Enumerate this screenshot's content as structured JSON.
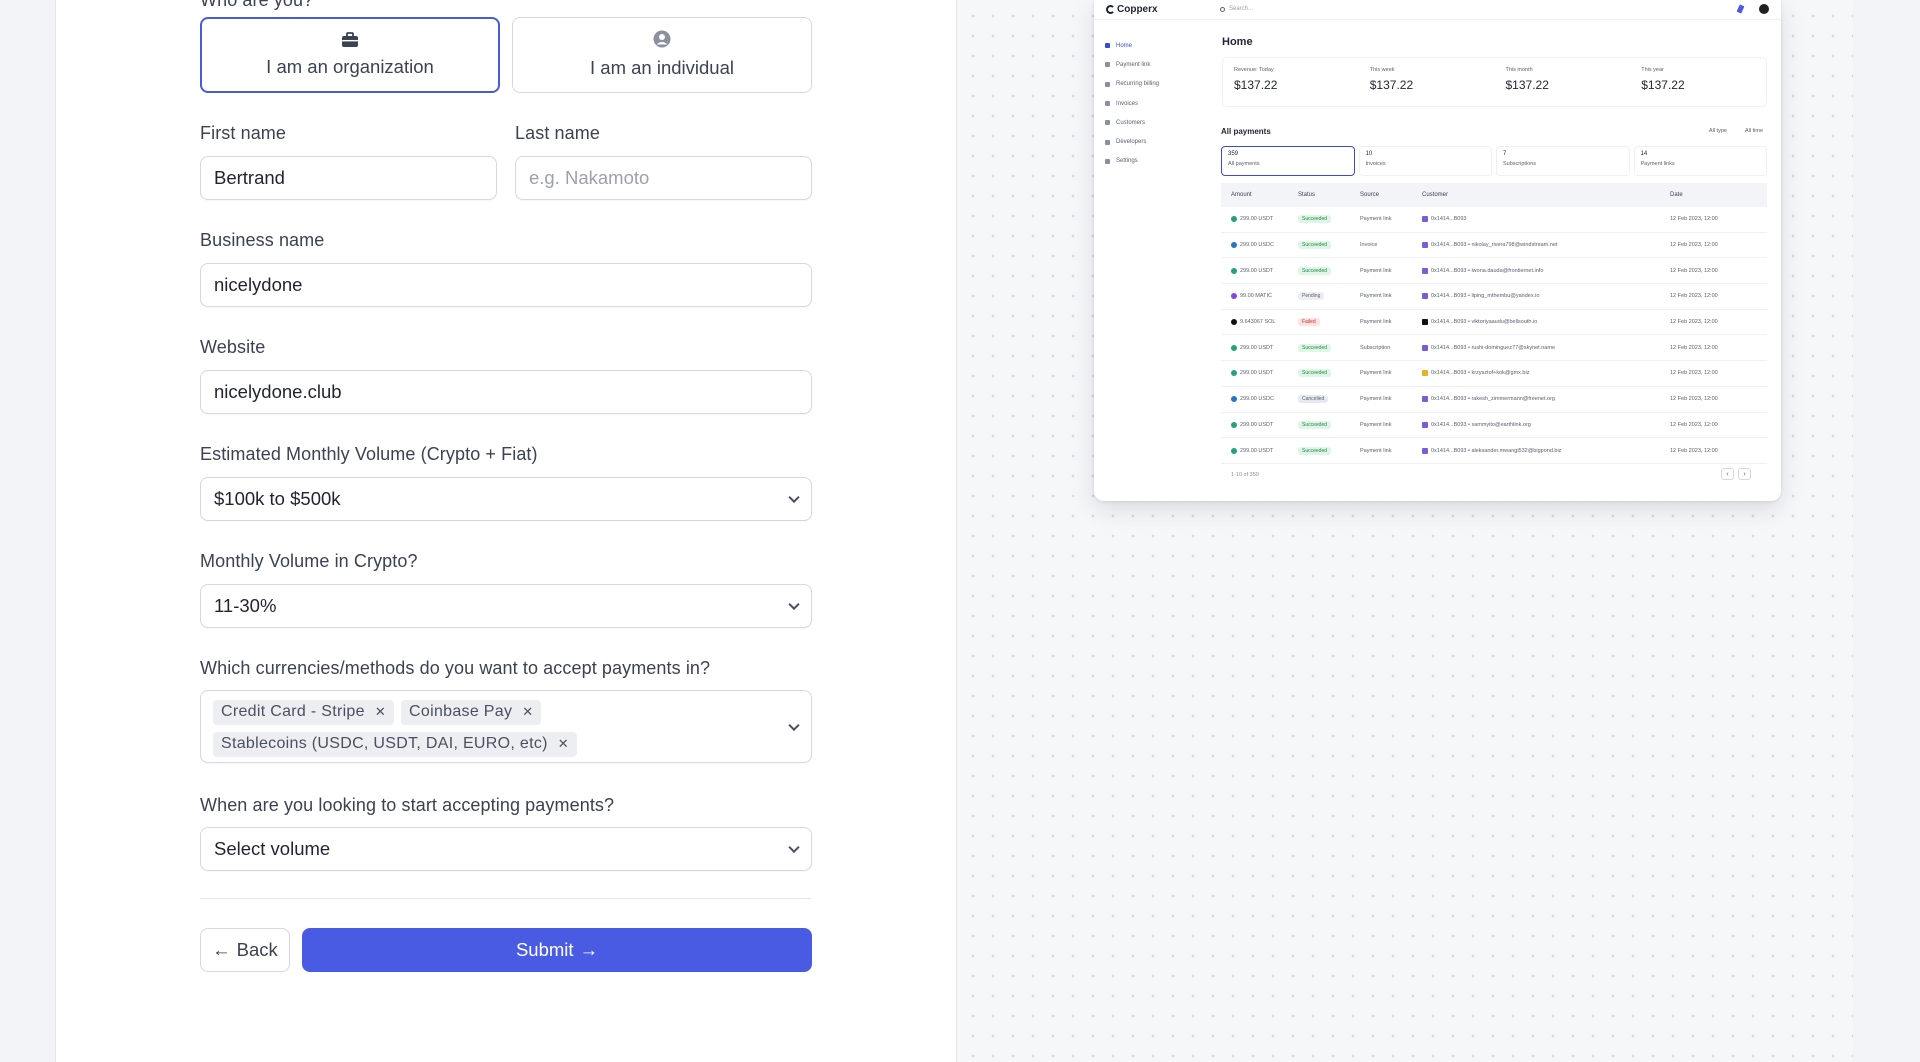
{
  "form": {
    "who_label": "Who are you?",
    "org_card": "I am an organization",
    "ind_card": "I am an individual",
    "first_name": {
      "label": "First name",
      "value": "Bertrand"
    },
    "last_name": {
      "label": "Last name",
      "placeholder": "e.g. Nakamoto"
    },
    "business_name": {
      "label": "Business name",
      "value": "nicelydone"
    },
    "website": {
      "label": "Website",
      "value": "nicelydone.club"
    },
    "monthly_volume": {
      "label": "Estimated Monthly Volume (Crypto + Fiat)",
      "value": "$100k to $500k"
    },
    "crypto_volume": {
      "label": "Monthly Volume in Crypto?",
      "value": "11-30%"
    },
    "currencies": {
      "label": "Which currencies/methods do you want to accept payments in?",
      "chips": [
        "Credit Card - Stripe",
        "Coinbase Pay",
        "Stablecoins (USDC, USDT, DAI, EURO, etc)"
      ]
    },
    "start_time": {
      "label": "When are you looking to start accepting payments?",
      "value": "Select volume"
    },
    "back_label": "Back",
    "submit_label": "Submit"
  },
  "preview": {
    "brand": "Copperx",
    "search_placeholder": "Search...",
    "sidebar": [
      "Home",
      "Payment link",
      "Recurring billing",
      "Invoices",
      "Customers",
      "Developers",
      "Settings"
    ],
    "page_title": "Home",
    "stats": [
      {
        "label": "Revenue: Today",
        "value": "$137.22"
      },
      {
        "label": "This week",
        "value": "$137.22"
      },
      {
        "label": "This month",
        "value": "$137.22"
      },
      {
        "label": "This year",
        "value": "$137.22"
      }
    ],
    "all_payments": "All payments",
    "filters": [
      "All type",
      "All time"
    ],
    "tabs": [
      {
        "count": "359",
        "label": "All payments"
      },
      {
        "count": "10",
        "label": "Invoices"
      },
      {
        "count": "7",
        "label": "Subscriptions"
      },
      {
        "count": "14",
        "label": "Payment links"
      }
    ],
    "columns": [
      "Amount",
      "Status",
      "Source",
      "Customer",
      "Date"
    ],
    "rows": [
      {
        "amount": "299.00 USDT",
        "coin": "#26a17b",
        "status": "Succeeded",
        "kind": "succ",
        "source": "Payment link",
        "sq": "#7c5cd6",
        "customer": "0x1414...B093",
        "date": "12 Feb 2023, 12:00"
      },
      {
        "amount": "299.00 USDC",
        "coin": "#2775ca",
        "status": "Succeeded",
        "kind": "succ",
        "source": "Invoice",
        "sq": "#7c5cd6",
        "customer": "0x1414...B093 • nikolay_rivera798@windstream.net",
        "date": "12 Feb 2023, 12:00"
      },
      {
        "amount": "299.00 USDT",
        "coin": "#26a17b",
        "status": "Succeeded",
        "kind": "succ",
        "source": "Payment link",
        "sq": "#7c5cd6",
        "customer": "0x1414...B093 • iwona.dauda@frontiernet.info",
        "date": "12 Feb 2023, 12:00"
      },
      {
        "amount": "99.00 MATIC",
        "coin": "#8247e5",
        "status": "Pending",
        "kind": "pend",
        "source": "Payment link",
        "sq": "#7c5cd6",
        "customer": "0x1414...B093 • liping_mthembu@yandex.io",
        "date": "12 Feb 2023, 12:00"
      },
      {
        "amount": "9.643067 SOL",
        "coin": "#111111",
        "status": "Failed",
        "kind": "fail",
        "source": "Payment link",
        "sq": "#111111",
        "customer": "0x1414...B093 • viktoriyaaudu@bellsouth.io",
        "date": "12 Feb 2023, 12:00"
      },
      {
        "amount": "299.00 USDT",
        "coin": "#26a17b",
        "status": "Succeeded",
        "kind": "succ",
        "source": "Subscription",
        "sq": "#7c5cd6",
        "customer": "0x1414...B093 • rushi-dominguez77@skynet.name",
        "date": "12 Feb 2023, 12:00"
      },
      {
        "amount": "299.00 USDT",
        "coin": "#26a17b",
        "status": "Succeeded",
        "kind": "succ",
        "source": "Payment link",
        "sq": "#e6b422",
        "customer": "0x1414...B093 • krzysztof+kok@gmx.biz",
        "date": "12 Feb 2023, 12:00"
      },
      {
        "amount": "299.00 USDC",
        "coin": "#2775ca",
        "status": "Cancelled",
        "kind": "canc",
        "source": "Payment link",
        "sq": "#7c5cd6",
        "customer": "0x1414...B093 • rakesh_zimmermann@freenet.org",
        "date": "12 Feb 2023, 12:00"
      },
      {
        "amount": "299.00 USDT",
        "coin": "#26a17b",
        "status": "Succeeded",
        "kind": "succ",
        "source": "Payment link",
        "sq": "#7c5cd6",
        "customer": "0x1414...B093 • sammyito@earthlink.org",
        "date": "12 Feb 2023, 12:00"
      },
      {
        "amount": "299.00 USDT",
        "coin": "#26a17b",
        "status": "Succeeded",
        "kind": "succ",
        "source": "Payment link",
        "sq": "#7c5cd6",
        "customer": "0x1414...B093 • aleksander.mwangi532@bigpond.biz",
        "date": "12 Feb 2023, 12:00"
      }
    ],
    "footer": "1-10 of 359"
  }
}
